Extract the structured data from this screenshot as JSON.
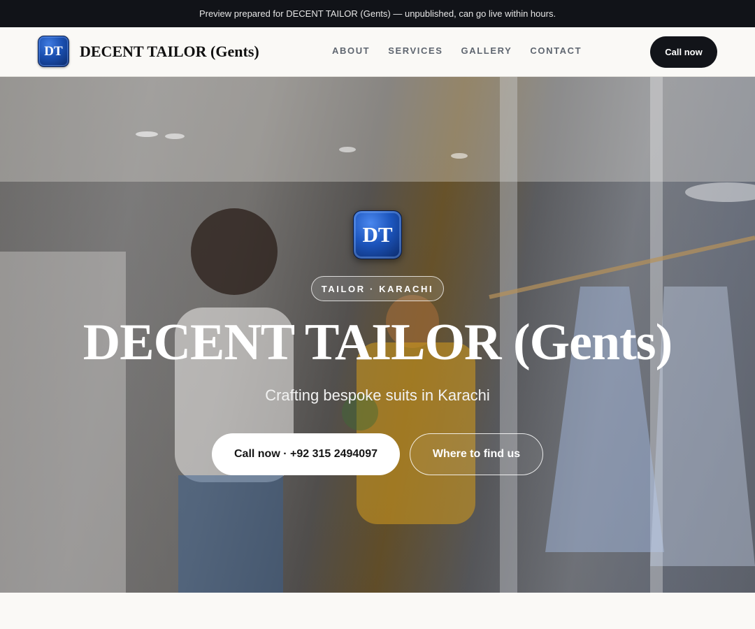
{
  "banner": {
    "text": "Preview prepared for DECENT TAILOR (Gents) — unpublished, can go live within hours."
  },
  "header": {
    "logo_text": "DT",
    "brand_name": "DECENT TAILOR (Gents)",
    "nav": [
      {
        "label": "ABOUT"
      },
      {
        "label": "SERVICES"
      },
      {
        "label": "GALLERY"
      },
      {
        "label": "CONTACT"
      }
    ],
    "cta_label": "Call now"
  },
  "hero": {
    "logo_text": "DT",
    "tag": "TAILOR · KARACHI",
    "title": "DECENT TAILOR (Gents)",
    "subtitle": "Crafting bespoke suits in Karachi",
    "primary_button": "Call now · +92 315 2494097",
    "secondary_button": "Where to find us",
    "background": "photo-of-clothing-store-interior"
  },
  "colors": {
    "banner_bg": "#111318",
    "header_cta_bg": "#121419",
    "logo_blue": "#1a4fb0",
    "page_bg": "#faf9f6"
  }
}
